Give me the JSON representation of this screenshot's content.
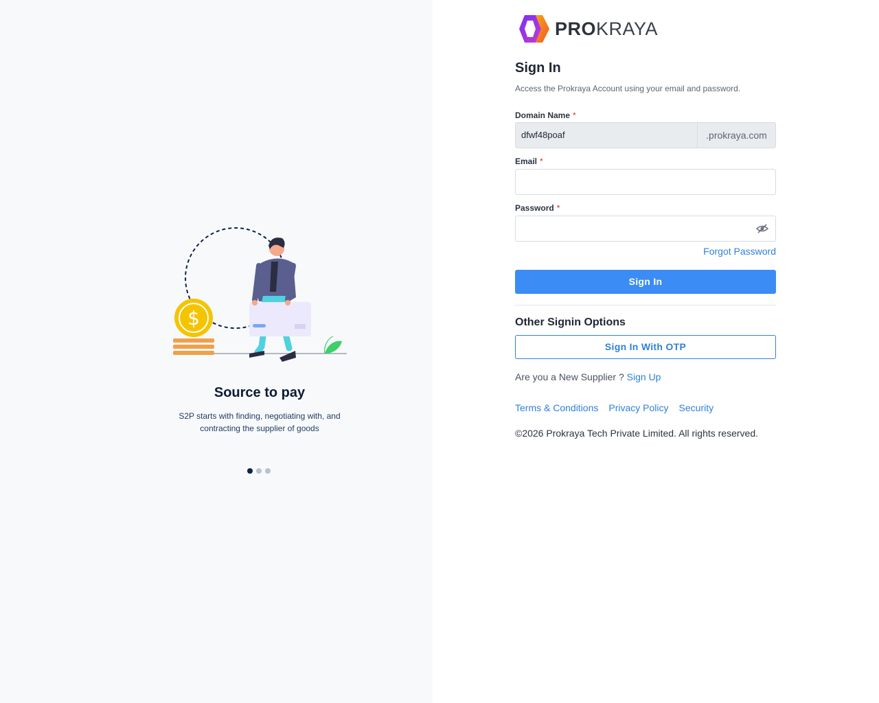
{
  "carousel": {
    "title": "Source to pay",
    "description": "S2P starts with finding, negotiating with, and contracting the supplier of goods",
    "slides_total": 3,
    "active_index": 0
  },
  "brand": {
    "logo_bold": "PRO",
    "logo_rest": "KRAYA"
  },
  "signin": {
    "title": "Sign In",
    "subtitle": "Access the Prokraya Account using your email and password.",
    "domain_label": "Domain Name",
    "domain_value": "dfwf48poaf",
    "domain_suffix": ".prokraya.com",
    "email_label": "Email",
    "email_value": "",
    "password_label": "Password",
    "password_value": "",
    "required_mark": "*",
    "forgot_label": "Forgot Password",
    "submit_label": "Sign In"
  },
  "other": {
    "heading": "Other Signin Options",
    "otp_label": "Sign In With OTP",
    "new_supplier_text": "Are you a New Supplier ?",
    "signup_label": "Sign Up"
  },
  "footer": {
    "terms": "Terms & Conditions",
    "privacy": "Privacy Policy",
    "security": "Security",
    "copyright": "©2026 Prokraya Tech Private Limited. All rights reserved."
  },
  "colors": {
    "primary": "#3b8cf5",
    "link": "#2f80d8",
    "required": "#e02424"
  }
}
